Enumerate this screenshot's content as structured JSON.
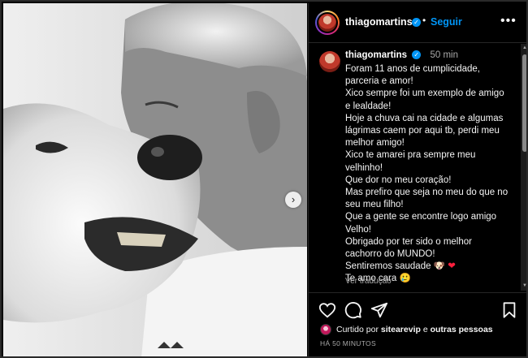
{
  "header": {
    "username": "thiagomartins",
    "separator": "•",
    "follow_label": "Seguir",
    "more_icon": "more-horizontal-icon"
  },
  "caption": {
    "username": "thiagomartins",
    "time": "50 min",
    "lines": [
      "Foram 11 anos de cumplicidade,",
      "parceria e amor!",
      "Xico sempre foi um exemplo de amigo",
      "e lealdade!",
      "Hoje a chuva cai na cidade e algumas",
      "lágrimas caem por aqui tb, perdi meu",
      "melhor amigo!",
      "Xico te amarei pra sempre meu",
      "velhinho!",
      "Que dor no meu coração!",
      "Mas prefiro que seja no meu do que no",
      "seu meu filho!",
      "Que a gente se encontre logo amigo",
      "Velho!",
      "Obrigado por ter sido o melhor",
      "cachorro do MUNDO!"
    ],
    "missing_line": "Sentiremos saudade",
    "missing_emoji": "🐶",
    "heart": "❤",
    "last_line": "Te amo cara 🥲",
    "see_translation": "Ver tradução"
  },
  "actions": {
    "liked_prefix": "Curtido por",
    "liked_user": "sitearevip",
    "liked_and": "e",
    "liked_others": "outras pessoas",
    "time_ago": "HÁ 50 MINUTOS"
  },
  "colors": {
    "accent": "#0095f6",
    "heart": "#ff1f3d"
  }
}
